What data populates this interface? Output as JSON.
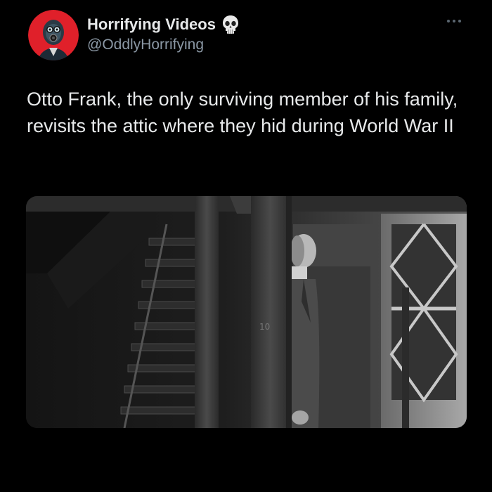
{
  "author": {
    "display_name": "Horrifying Videos",
    "handle": "@OddlyHorrifying",
    "avatar_icon": "gas-mask-avatar",
    "badge_icon": "skull-emoji"
  },
  "menu": {
    "icon": "more-horizontal-icon"
  },
  "tweet": {
    "text": "Otto Frank, the only surviving member of his family, revisits the attic where they hid during World War II"
  },
  "media": {
    "kind": "black-and-white photograph",
    "scene": "man in suit standing beside a wooden beam in an attic with a staircase and a lattice-window door"
  },
  "colors": {
    "background": "#000000",
    "text_primary": "#e7e9ea",
    "text_secondary": "#8b98a5",
    "avatar_bg": "#e0202a"
  }
}
